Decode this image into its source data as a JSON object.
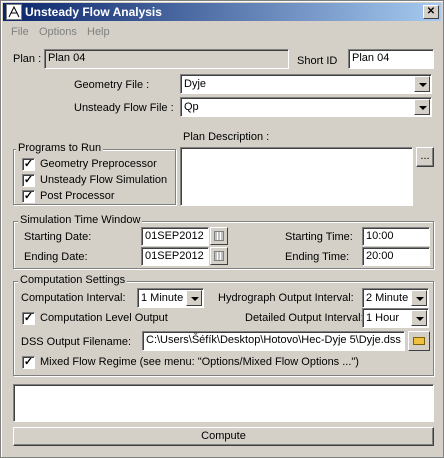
{
  "window": {
    "title": "Unsteady Flow Analysis",
    "close_label": "✕"
  },
  "menu": [
    "File",
    "Options",
    "Help"
  ],
  "plan": {
    "label": "Plan :",
    "value": "Plan 04",
    "short_id_label": "Short ID",
    "short_id_value": "Plan 04"
  },
  "geometry": {
    "label": "Geometry File :",
    "value": "Dyje"
  },
  "unsteady": {
    "label": "Unsteady Flow File :",
    "value": "Qp"
  },
  "programs": {
    "title": "Programs to Run",
    "items": [
      {
        "label": "Geometry Preprocessor",
        "checked": "✓"
      },
      {
        "label": "Unsteady Flow Simulation",
        "checked": "✓"
      },
      {
        "label": "Post Processor",
        "checked": "✓"
      }
    ]
  },
  "description": {
    "label": "Plan Description :",
    "button": "..."
  },
  "time_window": {
    "title": "Simulation Time Window",
    "start_date_label": "Starting Date:",
    "start_date": "01SEP2012",
    "end_date_label": "Ending Date:",
    "end_date": "01SEP2012",
    "start_time_label": "Starting Time:",
    "start_time": "10:00",
    "end_time_label": "Ending Time:",
    "end_time": "20:00"
  },
  "computation": {
    "title": "Computation Settings",
    "interval_label": "Computation Interval:",
    "interval": "1 Minute",
    "hydro_label": "Hydrograph Output Interval:",
    "hydro": "2 Minute",
    "level_output_label": "Computation Level Output",
    "level_output_checked": "✓",
    "detailed_label": "Detailed Output Interval:",
    "detailed": "1 Hour",
    "dss_label": "DSS Output Filename:",
    "dss_value": "C:\\Users\\Šéfík\\Desktop\\Hotovo\\Hec-Dyje 5\\Dyje.dss",
    "mixed_label": "Mixed Flow Regime (see menu: \"Options/Mixed Flow Options ...\")",
    "mixed_checked": "✓"
  },
  "compute_button": "Compute"
}
